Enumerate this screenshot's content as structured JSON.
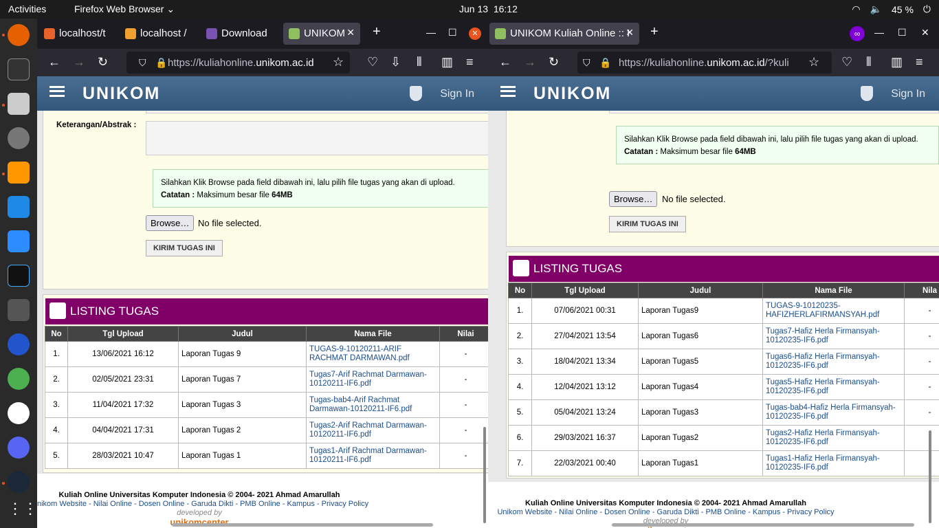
{
  "topbar": {
    "activities": "Activities",
    "app": "Firefox Web Browser ⌄",
    "date": "Jun 13",
    "time": "16:12",
    "battery": "45 %"
  },
  "left": {
    "tabs": [
      "localhost/t",
      "localhost /",
      "Download",
      "UNIKOM"
    ],
    "url_pre": "https://kuliahonline.",
    "url_dom": "unikom.ac.id",
    "logo": "UNIKOM",
    "signin": "Sign In",
    "keterangan": "Keterangan/Abstrak :",
    "notice1": "Silahkan Klik Browse pada field dibawah ini, lalu pilih file tugas yang akan di upload.",
    "catatan": "Catatan :",
    "maks": "Maksimum besar file",
    "size": "64MB",
    "browse": "Browse…",
    "nofile": "No file selected.",
    "kirim": "KIRIM TUGAS INI",
    "listing": "LISTING TUGAS",
    "cols": [
      "No",
      "Tgl Upload",
      "Judul",
      "Nama File",
      "Nilai"
    ],
    "rows": [
      [
        "1.",
        "13/06/2021 16:12",
        "Laporan Tugas 9",
        "TUGAS-9-10120211-ARIF RACHMAT DARMAWAN.pdf",
        "-"
      ],
      [
        "2.",
        "02/05/2021 23:31",
        "Laporan Tugas 7",
        "Tugas7-Arif Rachmat Darmawan-10120211-IF6.pdf",
        "-"
      ],
      [
        "3.",
        "11/04/2021 17:32",
        "Laporan Tugas 3",
        "Tugas-bab4-Arif Rachmat Darmawan-10120211-IF6.pdf",
        "-"
      ],
      [
        "4.",
        "04/04/2021 17:31",
        "Laporan Tugas 2",
        "Tugas2-Arif Rachmat Darmawan-10120211-IF6.pdf",
        "-"
      ],
      [
        "5.",
        "28/03/2021 10:47",
        "Laporan Tugas 1",
        "Tugas1-Arif Rachmat Darmawan-10120211-IF6.pdf",
        "-"
      ]
    ],
    "footer1": "Kuliah Online Universitas Komputer Indonesia © 2004- 2021 Ahmad Amarullah",
    "footer2": "nikom Website - Nilai Online - Dosen Online - Garuda Dikti - PMB Online - Kampus - Privacy Policy",
    "dev": "developed by",
    "uc": "unikomcenter"
  },
  "right": {
    "tab": "UNIKOM Kuliah Online :: I",
    "url_pre": "https://kuliahonline.",
    "url_dom": "unikom.ac.id",
    "url_post": "/?kuli",
    "logo": "UNIKOM",
    "signin": "Sign In",
    "notice1": "Silahkan Klik Browse pada field dibawah ini, lalu pilih file tugas yang akan di upload.",
    "catatan": "Catatan :",
    "maks": "Maksimum besar file",
    "size": "64MB",
    "browse": "Browse…",
    "nofile": "No file selected.",
    "kirim": "KIRIM TUGAS INI",
    "listing": "LISTING TUGAS",
    "cols": [
      "No",
      "Tgl Upload",
      "Judul",
      "Nama File",
      "Nila"
    ],
    "rows": [
      [
        "1.",
        "07/06/2021 00:31",
        "Laporan Tugas9",
        "TUGAS-9-10120235-HAFIZHERLAFIRMANSYAH.pdf",
        "-"
      ],
      [
        "2.",
        "27/04/2021 13:54",
        "Laporan Tugas6",
        "Tugas7-Hafiz Herla Firmansyah-10120235-IF6.pdf",
        "-"
      ],
      [
        "3.",
        "18/04/2021 13:34",
        "Laporan Tugas5",
        "Tugas6-Hafiz Herla Firmansyah-10120235-IF6.pdf",
        "-"
      ],
      [
        "4.",
        "12/04/2021 13:12",
        "Laporan Tugas4",
        "Tugas5-Hafiz Herla Firmansyah-10120235-IF6.pdf",
        "-"
      ],
      [
        "5.",
        "05/04/2021 13:24",
        "Laporan Tugas3",
        "Tugas-bab4-Hafiz Herla Firmansyah-10120235-IF6.pdf",
        "-"
      ],
      [
        "6.",
        "29/03/2021 16:37",
        "Laporan Tugas2",
        "Tugas2-Hafiz Herla Firmansyah-10120235-IF6.pdf",
        "-"
      ],
      [
        "7.",
        "22/03/2021 00:40",
        "Laporan Tugas1",
        "Tugas1-Hafiz Herla Firmansyah-10120235-IF6.pdf",
        "-"
      ]
    ],
    "footer1": "Kuliah Online Universitas Komputer Indonesia © 2004- 2021 Ahmad Amarullah",
    "footer2": "Unikom Website - Nilai Online - Dosen Online - Garuda Dikti - PMB Online - Kampus - Privacy Policy",
    "dev": "developed by",
    "uc": "unikomcenter"
  },
  "colors": {
    "header": "#3f6388",
    "listing": "#800068",
    "card": "#fefee8",
    "link": "#1a4d8c"
  }
}
